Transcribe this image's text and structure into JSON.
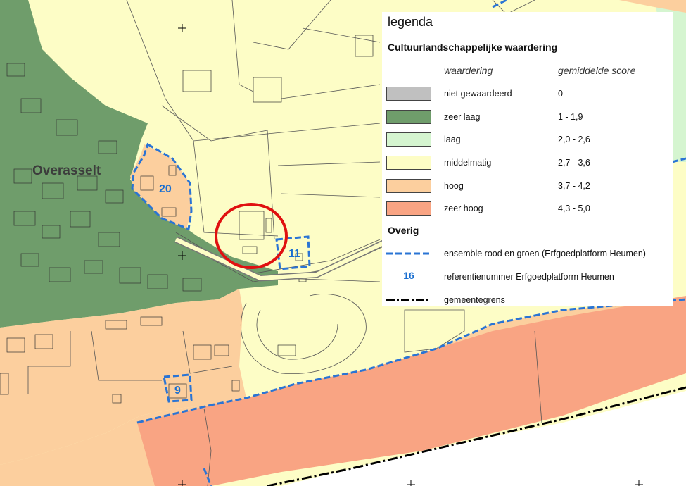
{
  "map": {
    "place_name": "Overasselt",
    "reference_numbers": [
      "20",
      "11",
      "9"
    ],
    "colors": {
      "zeer_laag": "#6f9d6b",
      "laag": "#d5f5d0",
      "middelmatig": "#fdfdc6",
      "hoog": "#fccf9e",
      "zeer_hoog": "#f9a483",
      "ensemble_line": "#2a74d4",
      "highlight_circle": "#e01010"
    }
  },
  "legend": {
    "title": "legenda",
    "section_waardering": "Cultuurlandschappelijke waardering",
    "column_waardering": "waardering",
    "column_score": "gemiddelde score",
    "classes": [
      {
        "label": "niet gewaardeerd",
        "score": "0",
        "color": "#c0c0c0"
      },
      {
        "label": "zeer laag",
        "score": "1 - 1,9",
        "color": "#6f9d6b"
      },
      {
        "label": "laag",
        "score": "2,0 - 2,6",
        "color": "#d5f5d0"
      },
      {
        "label": "middelmatig",
        "score": "2,7 - 3,6",
        "color": "#fdfdc6"
      },
      {
        "label": "hoog",
        "score": "3,7 - 4,2",
        "color": "#fccf9e"
      },
      {
        "label": "zeer hoog",
        "score": "4,3 - 5,0",
        "color": "#f9a483"
      }
    ],
    "section_overig": "Overig",
    "other": [
      {
        "label": "ensemble rood en groen (Erfgoedplatform Heumen)",
        "symbol": "dashed-blue-line"
      },
      {
        "label": "referentienummer Erfgoedplatform Heumen",
        "symbol_text": "16"
      },
      {
        "label": "gemeentegrens",
        "symbol": "dash-dot-black-line"
      }
    ]
  }
}
